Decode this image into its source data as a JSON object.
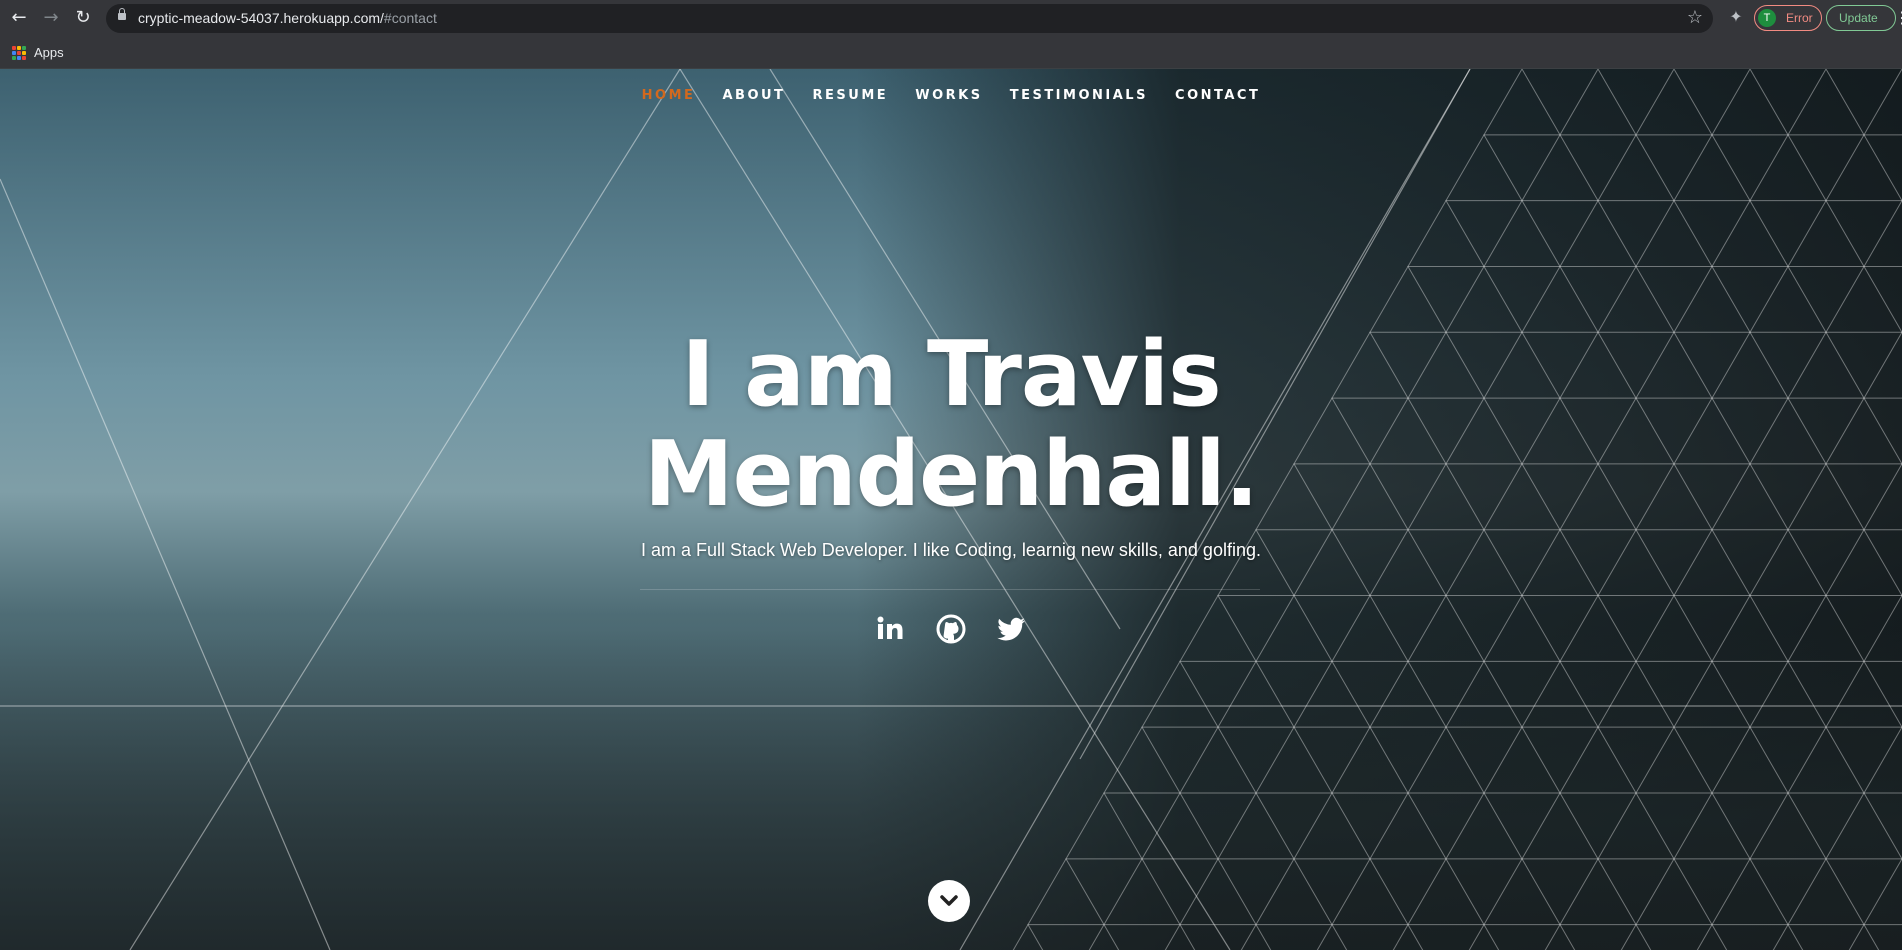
{
  "browser": {
    "url_host": "cryptic-meadow-54037.herokuapp.com/",
    "url_hash": "#contact",
    "profile_initial": "T",
    "profile_status": "Error",
    "update_label": "Update",
    "bookmarks": {
      "apps_label": "Apps"
    },
    "icons": [
      "back-arrow-icon",
      "forward-arrow-icon",
      "reload-icon",
      "lock-icon",
      "star-icon",
      "puzzle-icon",
      "kebab-menu-icon",
      "apps-grid-icon"
    ]
  },
  "nav": {
    "items": [
      {
        "label": "HOME",
        "active": true
      },
      {
        "label": "ABOUT"
      },
      {
        "label": "RESUME"
      },
      {
        "label": "WORKS"
      },
      {
        "label": "TESTIMONIALS"
      },
      {
        "label": "CONTACT"
      }
    ],
    "active_color": "#d2691e"
  },
  "hero": {
    "headline_line1": "I am Travis",
    "headline_line2": "Mendenhall.",
    "tagline": "I am a Full Stack Web Developer. I like Coding, learnig new skills, and golfing.",
    "social_icons": [
      "linkedin-icon",
      "github-icon",
      "twitter-icon"
    ],
    "scroll_icon": "chevron-down-icon"
  }
}
